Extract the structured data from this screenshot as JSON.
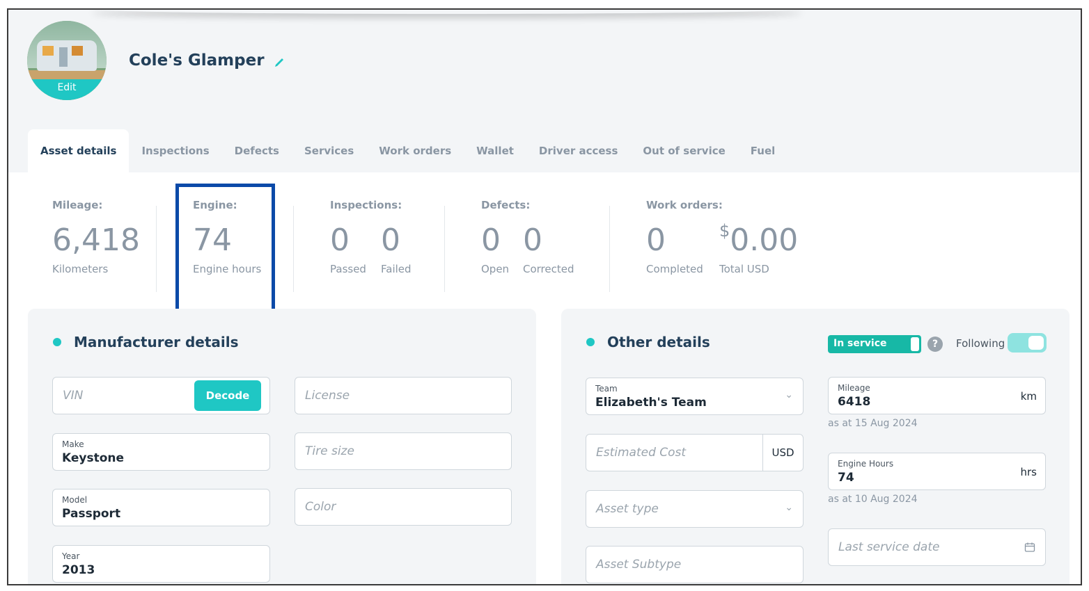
{
  "asset": {
    "name": "Cole's Glamper",
    "avatar_edit": "Edit"
  },
  "tabs": [
    "Asset details",
    "Inspections",
    "Defects",
    "Services",
    "Work orders",
    "Wallet",
    "Driver access",
    "Out of service",
    "Fuel"
  ],
  "stats": {
    "mileage": {
      "label": "Mileage:",
      "value": "6,418",
      "unit": "Kilometers"
    },
    "engine": {
      "label": "Engine:",
      "value": "74",
      "unit": "Engine hours"
    },
    "inspections": {
      "label": "Inspections:",
      "passed": "0",
      "passed_label": "Passed",
      "failed": "0",
      "failed_label": "Failed"
    },
    "defects": {
      "label": "Defects:",
      "open": "0",
      "open_label": "Open",
      "corrected": "0",
      "corrected_label": "Corrected"
    },
    "work_orders": {
      "label": "Work orders:",
      "completed": "0",
      "completed_label": "Completed",
      "currency_symbol": "$",
      "total": "0.00",
      "total_label": "Total USD"
    }
  },
  "manufacturer": {
    "title": "Manufacturer details",
    "vin_placeholder": "VIN",
    "decode_label": "Decode",
    "license_placeholder": "License",
    "make_label": "Make",
    "make_value": "Keystone",
    "tire_placeholder": "Tire size",
    "model_label": "Model",
    "model_value": "Passport",
    "color_placeholder": "Color",
    "year_label": "Year",
    "year_value": "2013"
  },
  "other": {
    "title": "Other details",
    "in_service_label": "In service",
    "help": "?",
    "following_label": "Following",
    "team_label": "Team",
    "team_value": "Elizabeth's Team",
    "est_cost_placeholder": "Estimated Cost",
    "currency": "USD",
    "asset_type_placeholder": "Asset type",
    "asset_subtype_placeholder": "Asset Subtype",
    "mileage_label": "Mileage",
    "mileage_value": "6418",
    "mileage_unit": "km",
    "mileage_asat": "as at 15 Aug 2024",
    "engine_label": "Engine Hours",
    "engine_value": "74",
    "engine_unit": "hrs",
    "engine_asat": "as at 10 Aug 2024",
    "last_service_placeholder": "Last service date"
  },
  "colors": {
    "accent": "#1fc7c4",
    "highlight": "#0b4aa8",
    "title": "#23405a"
  }
}
